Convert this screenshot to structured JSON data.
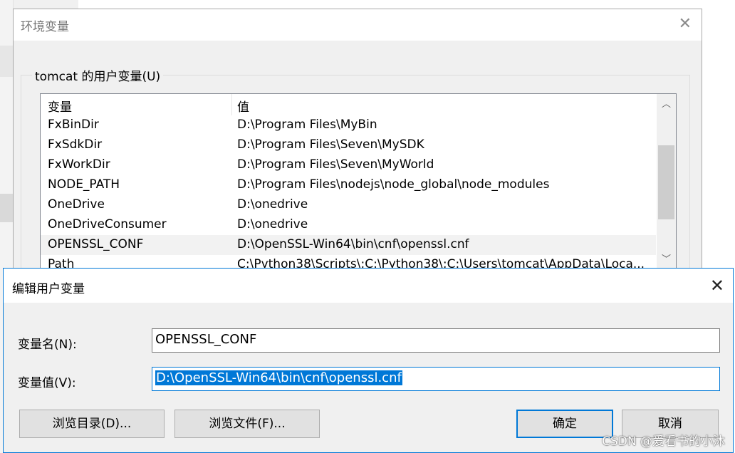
{
  "env_window": {
    "title": "环境变量",
    "group_label": "tomcat 的用户变量(U)",
    "columns": [
      "变量",
      "值"
    ],
    "rows": [
      {
        "name": "FxBinDir",
        "value": "D:\\Program Files\\MyBin"
      },
      {
        "name": "FxSdkDir",
        "value": "D:\\Program Files\\Seven\\MySDK"
      },
      {
        "name": "FxWorkDir",
        "value": "D:\\Program Files\\Seven\\MyWorld"
      },
      {
        "name": "NODE_PATH",
        "value": "D:\\Program Files\\nodejs\\node_global\\node_modules"
      },
      {
        "name": "OneDrive",
        "value": "D:\\onedrive"
      },
      {
        "name": "OneDriveConsumer",
        "value": "D:\\onedrive"
      },
      {
        "name": "OPENSSL_CONF",
        "value": "D:\\OpenSSL-Win64\\bin\\cnf\\openssl.cnf"
      },
      {
        "name": "Path",
        "value": "C:\\Python38\\Scripts\\;C:\\Python38\\;C:\\Users\\tomcat\\AppData\\Loca..."
      }
    ],
    "selected_row": "OPENSSL_CONF"
  },
  "edit_dialog": {
    "title": "编辑用户变量",
    "name_label": "变量名(N):",
    "name_value": "OPENSSL_CONF",
    "value_label": "变量值(V):",
    "value_value": "D:\\OpenSSL-Win64\\bin\\cnf\\openssl.cnf",
    "browse_dir_label": "浏览目录(D)...",
    "browse_file_label": "浏览文件(F)...",
    "ok_label": "确定",
    "cancel_label": "取消"
  },
  "icons": {
    "close": "close-icon",
    "scroll_up": "chevron-up-icon",
    "scroll_down": "chevron-down-icon"
  },
  "watermark": "CSDN @爱看书的小沐",
  "colors": {
    "accent": "#0078d7",
    "dialog_bg": "#f0f0f0",
    "selected_row": "#f2f2f2"
  }
}
